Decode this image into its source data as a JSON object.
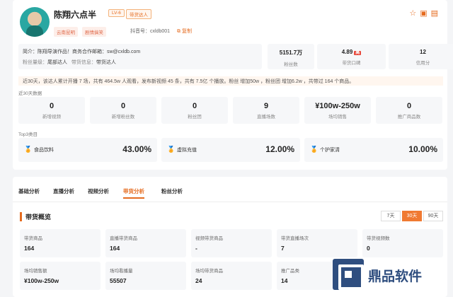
{
  "profile": {
    "name": "陈翔六点半",
    "level": "LV-6",
    "badge": "带货达人",
    "tags": [
      "云南昆明",
      "剧情搞笑"
    ],
    "douyin_label": "抖音号：cxldb001",
    "copy_label": "复制",
    "intro_line": "简介：陈翔导演作品！商务合作邮箱：sw@cxldb.com",
    "fans_level_label": "粉丝量级：",
    "fans_level_value": "尾部达人",
    "goods_info_label": "带货信息：",
    "goods_info_value": "带货达人"
  },
  "stats": [
    {
      "value": "5151.7万",
      "label": "粉丝数"
    },
    {
      "value": "4.89",
      "tag": "高",
      "label": "带货口碑"
    },
    {
      "value": "12",
      "label": "信用分"
    }
  ],
  "notice": {
    "text": "近30天，该达人累计开播 7 场，共有 464.5w 人观看，发布新视频 45 条，共有 7.5亿 个播放。粉丝 增加50w ，粉丝团 增加6.2w ，共带过 164 个商品。"
  },
  "recent": {
    "label": "近30天数据",
    "items": [
      {
        "value": "0",
        "label": "新增视频"
      },
      {
        "value": "0",
        "label": "新增粉丝数"
      },
      {
        "value": "0",
        "label": "粉丝团"
      },
      {
        "value": "9",
        "label": "直播场数"
      },
      {
        "value": "¥100w-250w",
        "label": "场均销售"
      },
      {
        "value": "0",
        "label": "推广商品数"
      }
    ]
  },
  "top3": {
    "label": "Top3类目",
    "items": [
      {
        "name": "食品饮料",
        "pct": "43.00%"
      },
      {
        "name": "虚拟充值",
        "pct": "12.00%"
      },
      {
        "name": "个护家清",
        "pct": "10.00%"
      }
    ]
  },
  "tabs": [
    "基础分析",
    "直播分析",
    "视频分析",
    "带货分析",
    "粉丝分析"
  ],
  "active_tab": "带货分析",
  "overview": {
    "title": "带货概览",
    "ranges": [
      "7天",
      "30天",
      "90天"
    ],
    "active_range": "30天",
    "row1": [
      {
        "label": "带货商品",
        "value": "164"
      },
      {
        "label": "直播带货商品",
        "value": "164"
      },
      {
        "label": "视频带货商品",
        "value": "-"
      },
      {
        "label": "带货直播场次",
        "value": "7"
      },
      {
        "label": "带货视频数",
        "value": "0"
      }
    ],
    "row2": [
      {
        "label": "场均销售额",
        "value": "¥100w-250w"
      },
      {
        "label": "场均看播量",
        "value": "55507"
      },
      {
        "label": "场均带货商品",
        "value": "24"
      },
      {
        "label": "推广品类",
        "value": "14"
      }
    ]
  },
  "watermark": {
    "text": "鼎品软件"
  },
  "colors": {
    "accent": "#e56b1f",
    "brand_blue": "#2f4e7f"
  }
}
